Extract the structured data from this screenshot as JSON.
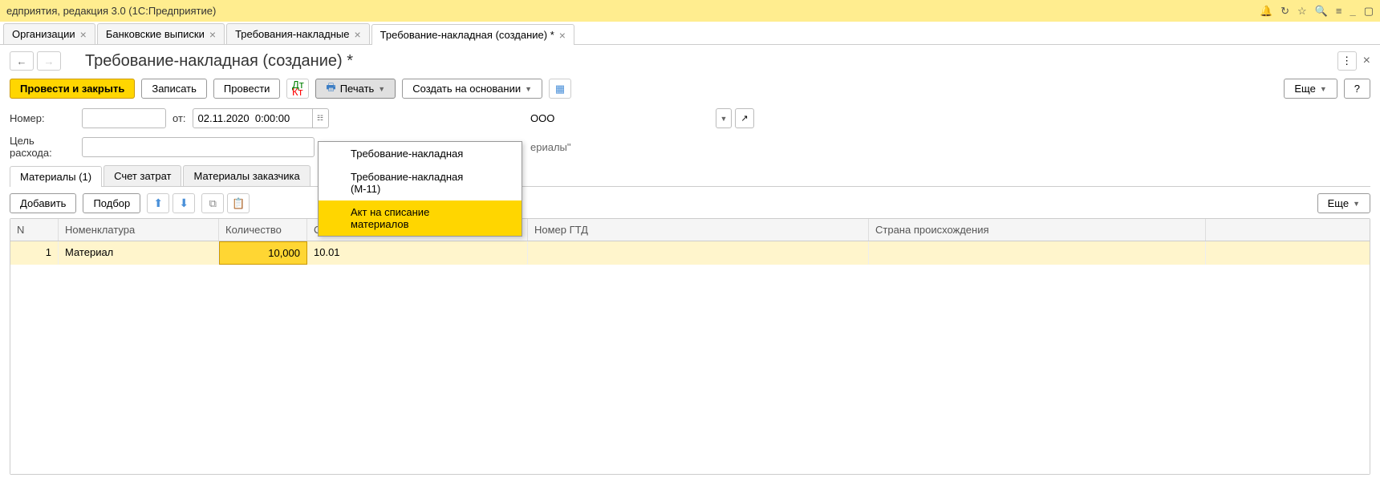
{
  "titlebar": {
    "text": "едприятия, редакция 3.0  (1С:Предприятие)"
  },
  "tabs": [
    {
      "label": "Организации",
      "active": false
    },
    {
      "label": "Банковские выписки",
      "active": false
    },
    {
      "label": "Требования-накладные",
      "active": false
    },
    {
      "label": "Требование-накладная (создание) *",
      "active": true
    }
  ],
  "page": {
    "title": "Требование-накладная (создание) *"
  },
  "toolbar": {
    "post_close": "Провести и закрыть",
    "save": "Записать",
    "post": "Провести",
    "print": "Печать",
    "create_based": "Создать на основании",
    "more": "Еще",
    "help": "?"
  },
  "print_menu": [
    {
      "label": "Требование-накладная",
      "highlighted": false
    },
    {
      "label": "Требование-накладная (М-11)",
      "highlighted": false
    },
    {
      "label": "Акт на списание материалов",
      "highlighted": true
    }
  ],
  "form": {
    "number_label": "Номер:",
    "number_value": "",
    "date_label": "от:",
    "date_value": "02.11.2020  0:00:00",
    "org_fragment": "ООО",
    "purpose_label": "Цель расхода:",
    "purpose_value": "",
    "hidden_text": "ериалы\""
  },
  "subtabs": [
    {
      "label": "Материалы (1)",
      "active": true
    },
    {
      "label": "Счет затрат",
      "active": false
    },
    {
      "label": "Материалы заказчика",
      "active": false
    }
  ],
  "subtoolbar": {
    "add": "Добавить",
    "select": "Подбор",
    "more": "Еще"
  },
  "grid": {
    "columns": [
      "N",
      "Номенклатура",
      "Количество",
      "Счет учета",
      "Номер ГТД",
      "Страна происхождения"
    ],
    "rows": [
      {
        "n": "1",
        "nom": "Материал",
        "qty": "10,000",
        "acct": "10.01",
        "gtd": "",
        "country": ""
      }
    ]
  }
}
